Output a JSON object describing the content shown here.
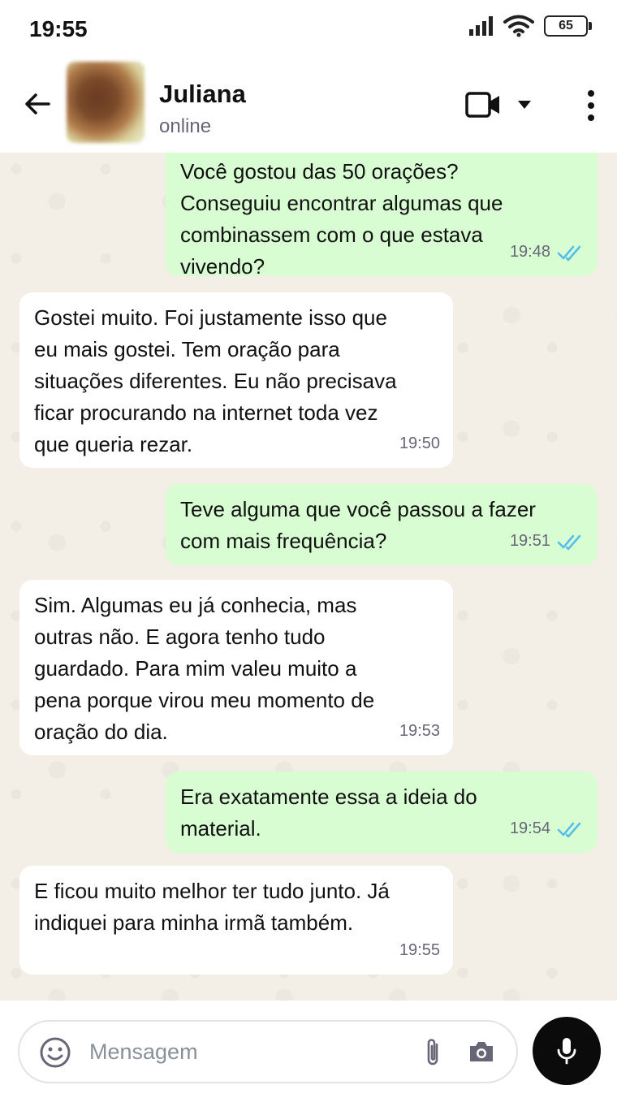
{
  "status_bar": {
    "time": "19:55",
    "battery": "65"
  },
  "header": {
    "contact_name": "Juliana",
    "contact_status": "online"
  },
  "messages": [
    {
      "direction": "out",
      "text": "Você gostou das 50 orações?\nConseguiu encontrar algumas que\ncombinassem com o que estava\nvivendo?",
      "time": "19:48",
      "read": true
    },
    {
      "direction": "in",
      "text": "Gostei muito. Foi justamente isso que\neu mais gostei. Tem oração para\nsituações diferentes. Eu não precisava\nficar procurando na internet toda vez\nque queria rezar.",
      "time": "19:50"
    },
    {
      "direction": "out",
      "text": "Teve alguma que você passou a fazer\ncom mais frequência?",
      "time": "19:51",
      "read": true
    },
    {
      "direction": "in",
      "text": "Sim. Algumas eu já conhecia, mas\noutras não. E agora tenho tudo\nguardado. Para mim valeu muito a\npena porque virou meu momento de\noração do dia.",
      "time": "19:53"
    },
    {
      "direction": "out",
      "text": "Era exatamente essa a ideia do\nmaterial.",
      "time": "19:54",
      "read": true
    },
    {
      "direction": "in",
      "text": "E ficou muito melhor ter tudo junto. Já\nindiquei para minha irmã também.",
      "time": "19:55"
    }
  ],
  "composer": {
    "placeholder": "Mensagem"
  },
  "colors": {
    "outgoing_bubble": "#d9fdd3",
    "incoming_bubble": "#ffffff",
    "read_ticks": "#53bdeb",
    "mic_button": "#0b0b0b"
  },
  "icons": [
    "back-arrow-icon",
    "video-call-icon",
    "chevron-down-icon",
    "more-vertical-icon",
    "emoji-icon",
    "attach-icon",
    "camera-icon",
    "mic-icon",
    "double-check-icon",
    "signal-icon",
    "wifi-icon",
    "battery-icon"
  ]
}
